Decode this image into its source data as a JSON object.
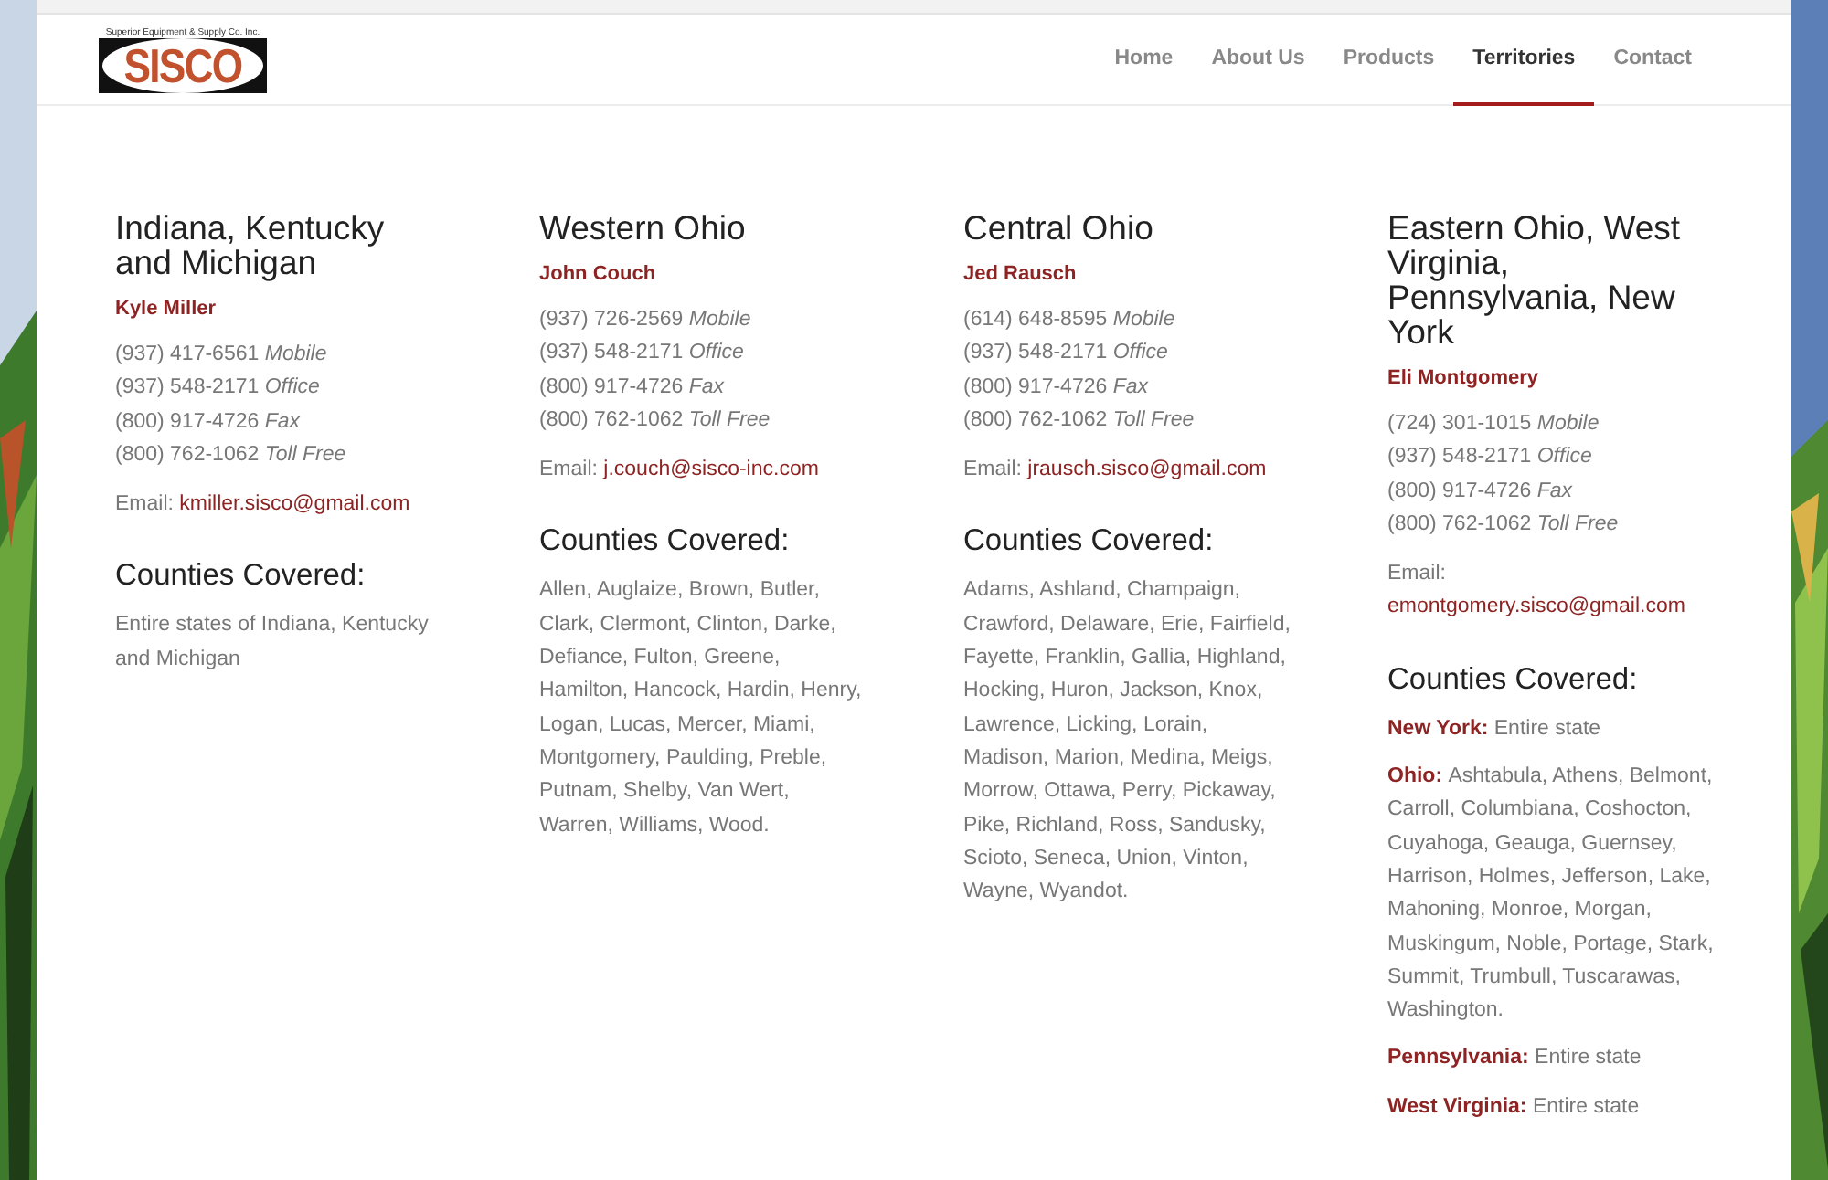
{
  "logo": {
    "tagline": "Superior Equipment & Supply Co. Inc.",
    "name": "SISCO"
  },
  "nav": [
    {
      "label": "Home",
      "selected": false
    },
    {
      "label": "About Us",
      "selected": false
    },
    {
      "label": "Products",
      "selected": false
    },
    {
      "label": "Territories",
      "selected": true
    },
    {
      "label": "Contact",
      "selected": false
    }
  ],
  "territories": [
    {
      "title": "Indiana, Kentucky and Michigan",
      "rep": "Kyle Miller",
      "phones": [
        {
          "number": "(937) 417-6561",
          "type": "Mobile"
        },
        {
          "number": "(937) 548-2171",
          "type": "Office"
        },
        {
          "number": "(800) 917-4726",
          "type": "Fax"
        },
        {
          "number": "(800) 762-1062",
          "type": "Toll Free"
        }
      ],
      "email_label": "Email:",
      "email": "kmiller.sisco@gmail.com",
      "counties_heading": "Counties Covered:",
      "counties": [
        {
          "text": "Entire states of Indiana, Kentucky and Michigan"
        }
      ]
    },
    {
      "title": "Western Ohio",
      "rep": "John Couch",
      "phones": [
        {
          "number": "(937) 726-2569",
          "type": "Mobile"
        },
        {
          "number": "(937) 548-2171",
          "type": "Office"
        },
        {
          "number": "(800) 917-4726",
          "type": "Fax"
        },
        {
          "number": "(800) 762-1062",
          "type": "Toll Free"
        }
      ],
      "email_label": "Email:",
      "email": "j.couch@sisco-inc.com",
      "counties_heading": "Counties Covered:",
      "counties": [
        {
          "text": "Allen, Auglaize, Brown, Butler, Clark, Clermont, Clinton, Darke, Defiance, Fulton, Greene, Hamilton, Hancock, Hardin, Henry, Logan, Lucas, Mercer, Miami, Montgomery, Paulding, Preble, Putnam, Shelby, Van Wert, Warren, Williams, Wood."
        }
      ]
    },
    {
      "title": "Central Ohio",
      "rep": "Jed Rausch",
      "phones": [
        {
          "number": "(614) 648-8595",
          "type": "Mobile"
        },
        {
          "number": "(937) 548-2171",
          "type": "Office"
        },
        {
          "number": "(800) 917-4726",
          "type": "Fax"
        },
        {
          "number": "(800) 762-1062",
          "type": "Toll Free"
        }
      ],
      "email_label": "Email:",
      "email": "jrausch.sisco@gmail.com",
      "counties_heading": "Counties Covered:",
      "counties": [
        {
          "text": "Adams, Ashland, Champaign, Crawford, Delaware, Erie, Fairfield, Fayette, Franklin, Gallia, Highland, Hocking, Huron, Jackson, Knox, Lawrence, Licking, Lorain, Madison, Marion, Medina, Meigs, Morrow, Ottawa, Perry, Pickaway, Pike, Richland, Ross, Sandusky, Scioto, Seneca, Union, Vinton, Wayne, Wyandot."
        }
      ]
    },
    {
      "title": "Eastern Ohio, West Virginia, Pennsylvania, New York",
      "rep": "Eli Montgomery",
      "phones": [
        {
          "number": "(724) 301-1015",
          "type": "Mobile"
        },
        {
          "number": "(937) 548-2171",
          "type": "Office"
        },
        {
          "number": "(800) 917-4726",
          "type": "Fax"
        },
        {
          "number": "(800) 762-1062",
          "type": "Toll Free"
        }
      ],
      "email_label": "Email:",
      "email": "emontgomery.sisco@gmail.com",
      "counties_heading": "Counties Covered:",
      "counties": [
        {
          "state": "New York:",
          "text": "Entire state"
        },
        {
          "state": "Ohio:",
          "text": "Ashtabula, Athens, Belmont, Carroll, Columbiana, Coshocton, Cuyahoga, Geauga, Guernsey, Harrison, Holmes, Jefferson, Lake, Mahoning, Monroe, Morgan, Muskingum, Noble, Portage, Stark, Summit, Trumbull, Tuscarawas, Washington."
        },
        {
          "state": "Pennsylvania:",
          "text": "Entire state"
        },
        {
          "state": "West Virginia:",
          "text": "Entire state"
        }
      ]
    }
  ]
}
